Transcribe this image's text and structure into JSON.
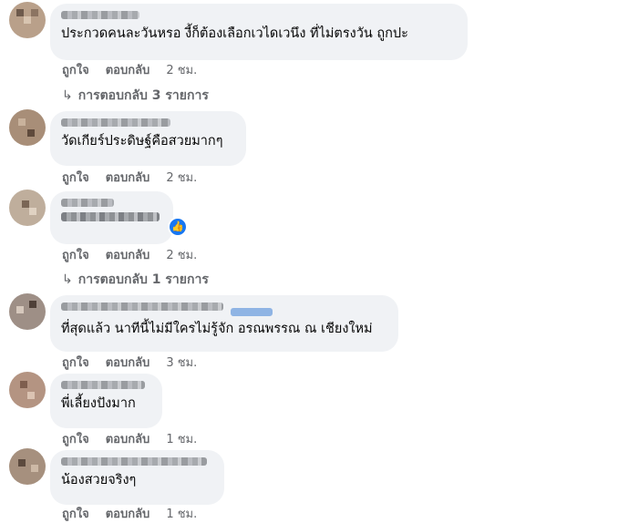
{
  "comments": [
    {
      "text": "ประกวดคนละวันหรอ งี้ก็ต้องเลือกเวไดเวนึง ที่ไม่ตรงวัน ถูกปะ",
      "like": "ถูกใจ",
      "reply": "ตอบกลับ",
      "time": "2 ชม.",
      "replies": "การตอบกลับ 3 รายการ"
    },
    {
      "text": "วัดเกียร์ประดิษฐ์คือสวยมากๆ",
      "like": "ถูกใจ",
      "reply": "ตอบกลับ",
      "time": "2 ชม."
    },
    {
      "text": "",
      "like": "ถูกใจ",
      "reply": "ตอบกลับ",
      "time": "2 ชม.",
      "replies": "การตอบกลับ 1 รายการ"
    },
    {
      "text": "ที่สุดแล้ว นาทีนี้ไม่มีใครไม่รู้จัก อรณพรรณ ณ เชียงใหม่",
      "like": "ถูกใจ",
      "reply": "ตอบกลับ",
      "time": "3 ชม."
    },
    {
      "text": "พี่เลี้ยงปังมาก",
      "like": "ถูกใจ",
      "reply": "ตอบกลับ",
      "time": "1 ชม."
    },
    {
      "text": "น้องสวยจริงๆ",
      "like": "ถูกใจ",
      "reply": "ตอบกลับ",
      "time": "1 ชม."
    }
  ],
  "icons": {
    "reply_arrow": "reply-arrow-icon",
    "like_badge": "thumbs-up-icon"
  },
  "colors": {
    "bubble": "#f0f2f5",
    "meta": "#65676b",
    "badge": "#1877f2"
  }
}
